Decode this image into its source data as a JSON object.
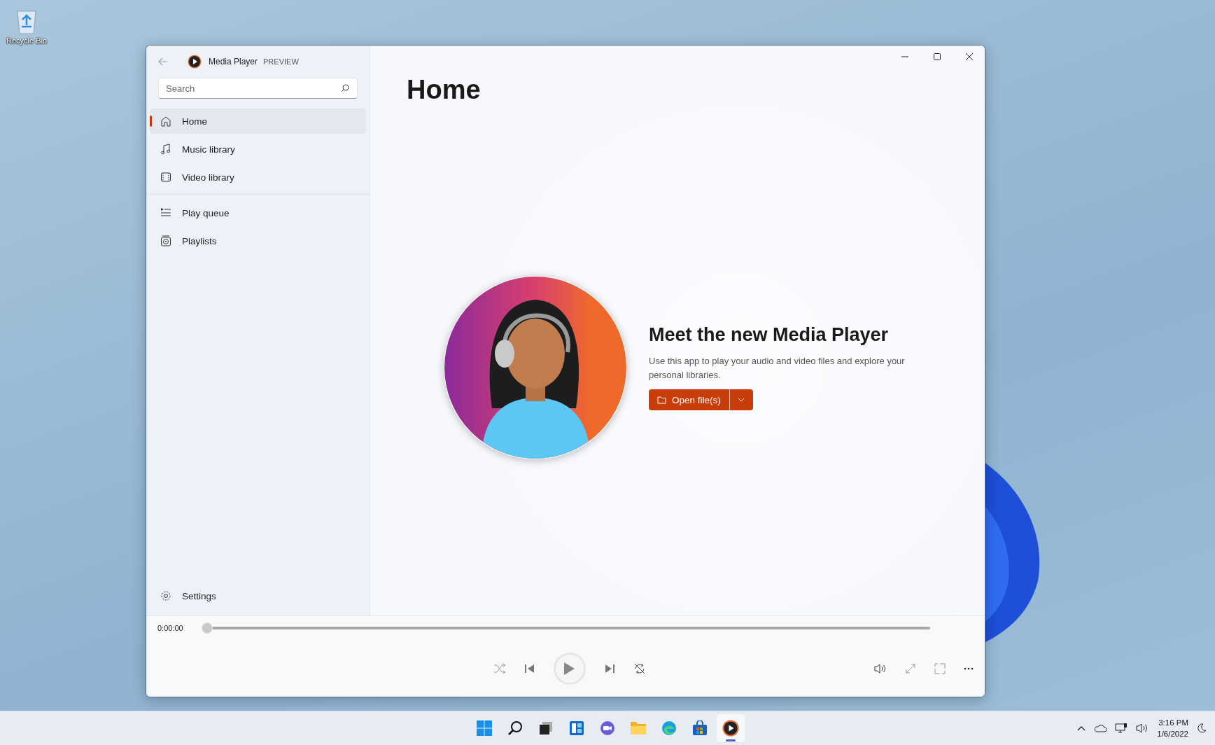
{
  "desktop": {
    "icons": [
      {
        "label": "Recycle Bin"
      }
    ]
  },
  "window": {
    "app_name": "Media Player",
    "badge": "PREVIEW"
  },
  "sidebar": {
    "search": {
      "placeholder": "Search"
    },
    "sections": [
      [
        {
          "label": "Home",
          "kind": "home",
          "selected": true
        },
        {
          "label": "Music library",
          "kind": "music",
          "selected": false
        },
        {
          "label": "Video library",
          "kind": "video",
          "selected": false
        }
      ],
      [
        {
          "label": "Play queue",
          "kind": "queue",
          "selected": false
        },
        {
          "label": "Playlists",
          "kind": "playlist",
          "selected": false
        }
      ]
    ],
    "settings": {
      "label": "Settings"
    }
  },
  "page": {
    "title": "Home",
    "headline": "Meet the new Media Player",
    "description": "Use this app to play your audio and video files and explore your personal libraries.",
    "button": "Open file(s)"
  },
  "player": {
    "time": "0:00:00",
    "level": 0,
    "controls": [
      {
        "kind": "shuffle"
      },
      {
        "kind": "previous"
      },
      {
        "kind": "play"
      },
      {
        "kind": "next"
      },
      {
        "kind": "repeat"
      }
    ],
    "extras": [
      {
        "kind": "volume"
      },
      {
        "kind": "fullscreen"
      },
      {
        "kind": "miniplayer"
      },
      {
        "kind": "more"
      }
    ]
  },
  "taskbar": {
    "apps": [
      {
        "kind": "start",
        "selected": false
      },
      {
        "kind": "search",
        "selected": false
      },
      {
        "kind": "taskview",
        "selected": false
      },
      {
        "kind": "widgets",
        "selected": false
      },
      {
        "kind": "chat",
        "selected": false
      },
      {
        "kind": "explorer",
        "selected": false
      },
      {
        "kind": "edge",
        "selected": false
      },
      {
        "kind": "store",
        "selected": false
      },
      {
        "kind": "mediaplayer",
        "selected": true
      }
    ],
    "tray": [
      {
        "kind": "chevron"
      },
      {
        "kind": "cloud"
      },
      {
        "kind": "network"
      },
      {
        "kind": "volume"
      }
    ],
    "time": "3:16 PM",
    "date": "1/6/2022"
  }
}
